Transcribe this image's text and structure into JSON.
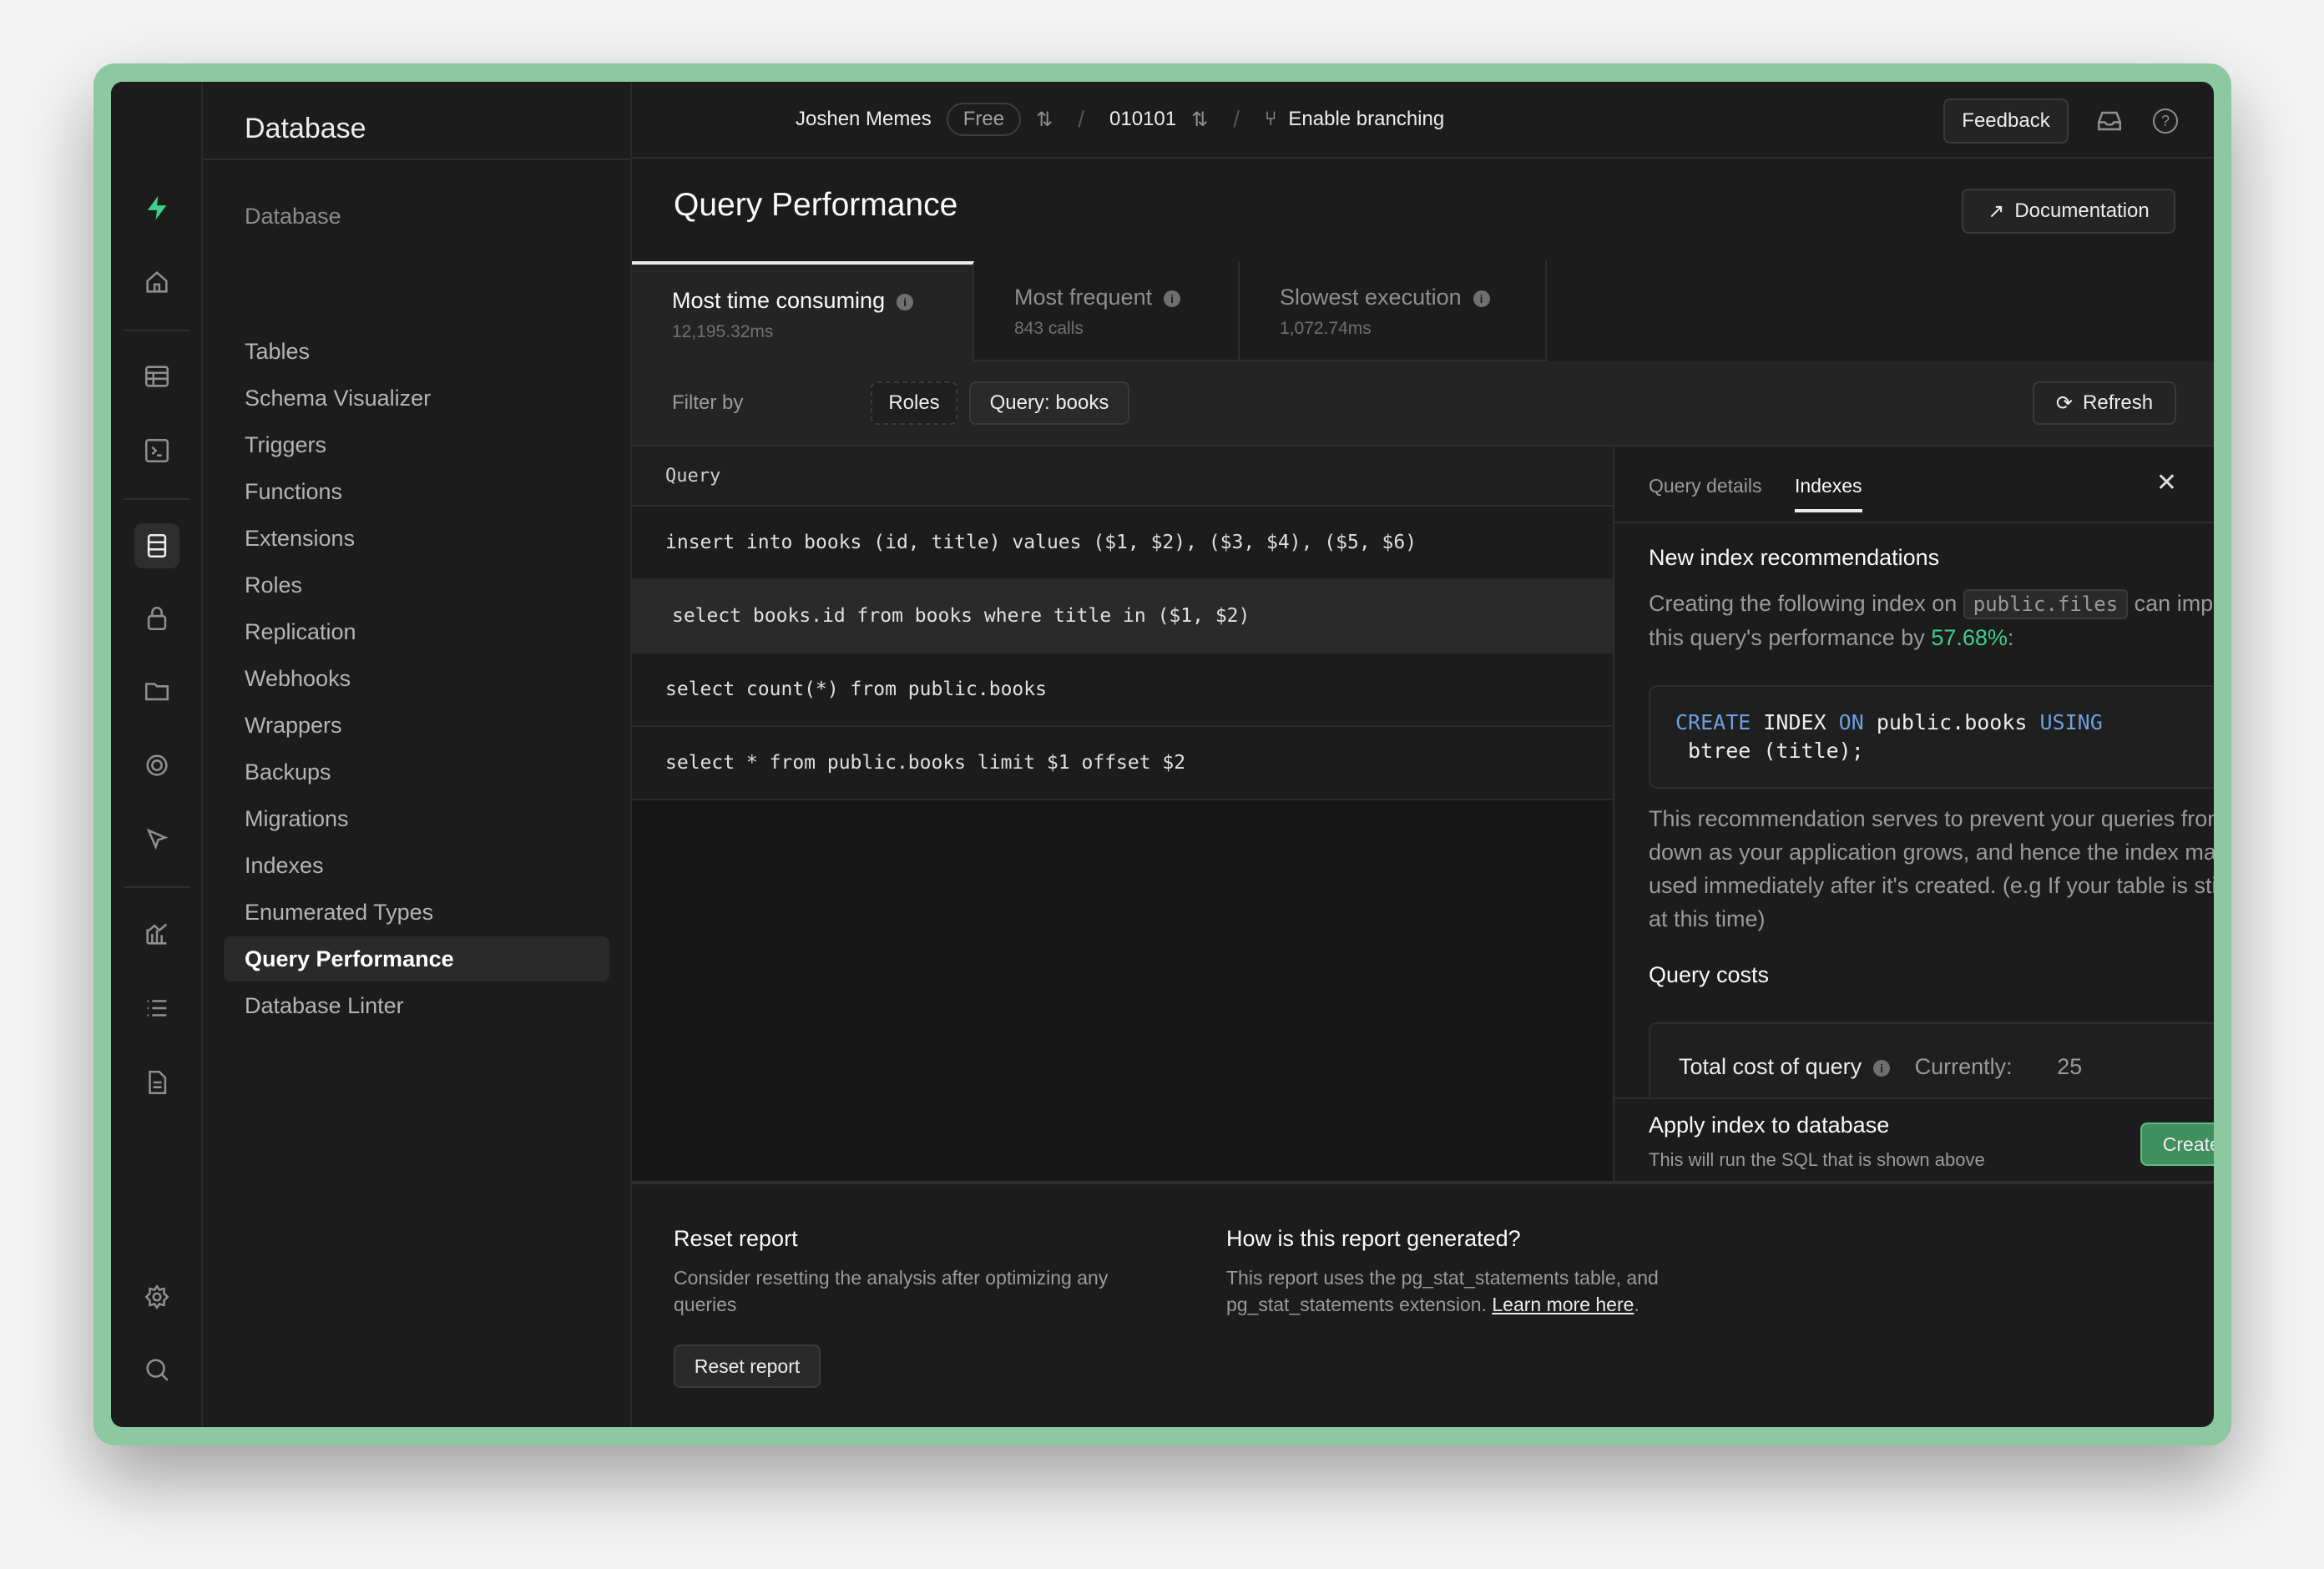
{
  "rail": {
    "items": [
      "home",
      "table-editor",
      "sql-editor",
      "database",
      "auth",
      "storage",
      "realtime",
      "edge-functions",
      "reports",
      "logs",
      "api-docs",
      "settings",
      "search",
      "account"
    ]
  },
  "nav": {
    "title": "Database",
    "section": "Database",
    "items": [
      "Tables",
      "Schema Visualizer",
      "Triggers",
      "Functions",
      "Extensions",
      "Roles",
      "Replication",
      "Webhooks",
      "Wrappers",
      "Backups",
      "Migrations",
      "Indexes",
      "Enumerated Types",
      "Query Performance",
      "Database Linter"
    ],
    "active": "Query Performance"
  },
  "topbar": {
    "org": "Joshen Memes",
    "plan": "Free",
    "project": "010101",
    "branching": "Enable branching",
    "feedback": "Feedback"
  },
  "page": {
    "title": "Query Performance",
    "docs": "Documentation"
  },
  "tabs": [
    {
      "label": "Most time consuming",
      "sub": "12,195.32ms"
    },
    {
      "label": "Most frequent",
      "sub": "843 calls"
    },
    {
      "label": "Slowest execution",
      "sub": "1,072.74ms"
    }
  ],
  "filter": {
    "label": "Filter by",
    "roles": "Roles",
    "query": "Query: books",
    "refresh": "Refresh"
  },
  "table": {
    "header": "Query",
    "rows": [
      "insert into books (id, title) values ($1, $2), ($3, $4), ($5, $6)",
      "select books.id from books where title in ($1, $2)",
      "select count(*) from public.books",
      "select * from public.books limit $1 offset $2"
    ]
  },
  "panel": {
    "tabs": [
      "Query details",
      "Indexes"
    ],
    "active_tab": "Indexes",
    "heading": "New index recommendations",
    "text1": "Creating the following index on",
    "table_name": "public.files",
    "text2": "can improve",
    "text3": "this query's performance by",
    "improvement": "57.68%",
    "colon": ":",
    "sql": {
      "k1": "CREATE",
      "t1": " INDEX ",
      "k2": "ON",
      "t2": " public.books ",
      "k3": "USING",
      "line2": " btree (title);"
    },
    "note": "This recommendation serves to prevent your queries from slowing down as your application grows, and hence the index may not be used immediately after it's created. (e.g If your table is still small at this time)",
    "costs_heading": "Query costs",
    "cost_label": "Total cost of query",
    "currently": "Currently:",
    "cost_value": "25",
    "apply_title": "Apply index to database",
    "apply_sub": "This will run the SQL that is shown above",
    "create": "Create index"
  },
  "bottom": {
    "reset_title": "Reset report",
    "reset_text": "Consider resetting the analysis after optimizing any queries",
    "reset_button": "Reset report",
    "how_title": "How is this report generated?",
    "how_text": "This report uses the pg_stat_statements table, and pg_stat_statements extension.",
    "learn": "Learn more here",
    "period": "."
  },
  "colors": {
    "accent": "#3ecf8e",
    "button_green": "#3f8f5f",
    "frame": "#8dc9a0"
  }
}
